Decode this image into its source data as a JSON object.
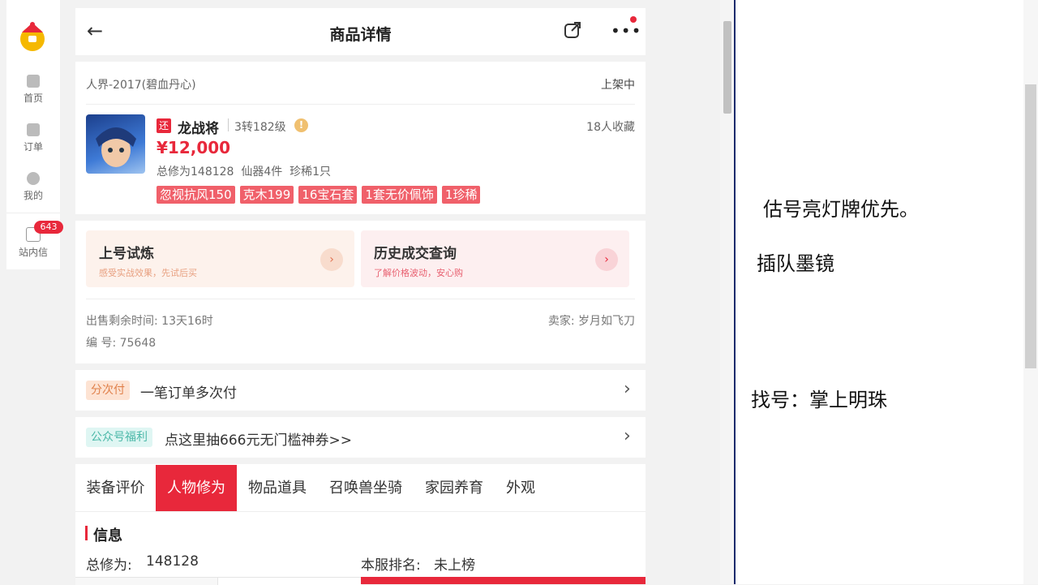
{
  "left_nav": {
    "items": [
      {
        "label": "首页",
        "icon": "home-icon"
      },
      {
        "label": "订单",
        "icon": "order-icon"
      },
      {
        "label": "我的",
        "icon": "user-icon"
      }
    ],
    "messages": {
      "label": "站内信",
      "badge": "643",
      "icon": "mail-icon"
    }
  },
  "header": {
    "title": "商品详情",
    "back_icon": "back-arrow-icon",
    "share_icon": "share-icon",
    "more_icon": "more-icon"
  },
  "product": {
    "server": "人界-2017(碧血丹心)",
    "status": "上架中",
    "return_badge": "还",
    "name": "龙战将",
    "level": "3转182级",
    "favorites": "18人收藏",
    "price": "¥12,000",
    "summary": "总修为148128  仙器4件  珍稀1只",
    "tags": [
      "忽视抗风150",
      "克木199",
      "16宝石套",
      "1套无价佩饰",
      "1珍稀"
    ]
  },
  "actions": [
    {
      "title": "上号试炼",
      "subtitle": "感受实战效果，先试后买"
    },
    {
      "title": "历史成交查询",
      "subtitle": "了解价格波动，安心购"
    }
  ],
  "sale_info": {
    "time_left": "出售剩余时间: 13天16时",
    "seller": "卖家: 岁月如飞刀",
    "serial": "编 号: 75648"
  },
  "installment": {
    "tag": "分次付",
    "text": "一笔订单多次付"
  },
  "promo": {
    "tag": "公众号福利",
    "text": "点这里抽666元无门槛神券>>"
  },
  "tabs": [
    "装备评价",
    "人物修为",
    "物品道具",
    "召唤兽坐骑",
    "家园养育",
    "外观"
  ],
  "active_tab": "人物修为",
  "info": {
    "heading": "信息",
    "total_label": "总修为:",
    "total_value": "148128",
    "rank_label": "本服排名:",
    "rank_value": "未上榜"
  },
  "notes": [
    "估号亮灯牌优先。",
    "插队墨镜",
    "找号：掌上明珠"
  ],
  "colors": {
    "accent": "#e8283b",
    "tag": "#f0606a"
  }
}
